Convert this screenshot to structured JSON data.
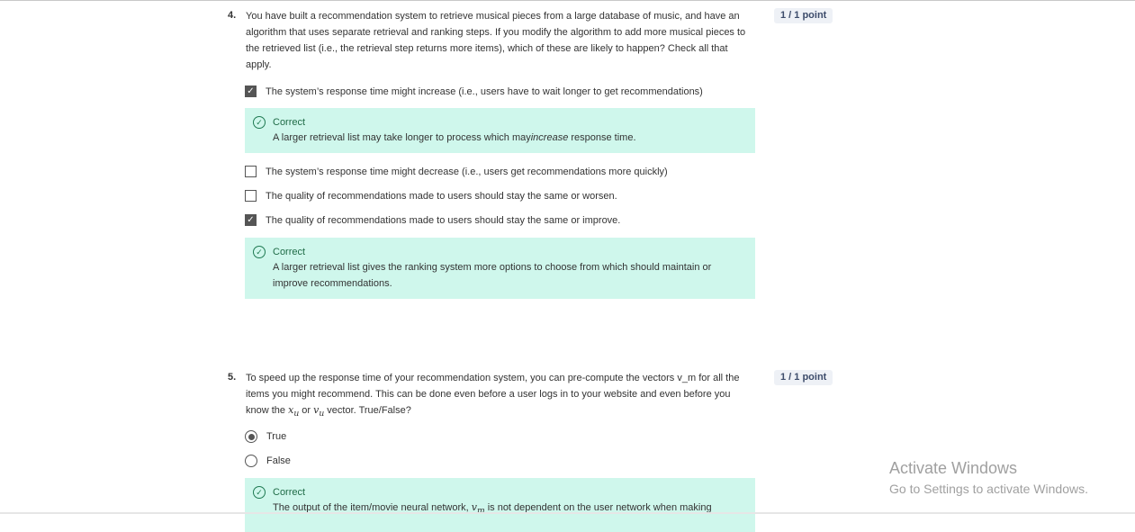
{
  "questions": [
    {
      "number": "4.",
      "text": "You have built a recommendation system to retrieve musical pieces from a large database of music, and have an algorithm that uses separate retrieval and ranking steps. If you modify the algorithm to add more musical pieces to the retrieved list (i.e., the retrieval step returns more items), which of these are likely to happen? Check all that apply.",
      "score": "1 / 1 point",
      "options": [
        {
          "label": "The system’s response time might increase (i.e., users have to wait longer to get recommendations)",
          "checked": true
        },
        {
          "label": "The system’s response time might decrease (i.e., users get recommendations more quickly)",
          "checked": false
        },
        {
          "label": "The quality of recommendations made to users should stay the same or worsen.",
          "checked": false
        },
        {
          "label": "The quality of recommendations made to users should stay the same or improve.",
          "checked": true
        }
      ],
      "feedback": [
        {
          "title": "Correct",
          "body_pre": "A larger retrieval list may take longer to process which may",
          "body_em": "increase",
          "body_post": " response time."
        },
        {
          "title": "Correct",
          "body": "A larger retrieval list gives the ranking system more options to choose from which should maintain or improve recommendations."
        }
      ]
    },
    {
      "number": "5.",
      "text_pre": "To speed up the response time of your recommendation system, you can pre-compute the vectors v_m for all the items you might recommend. This can be done even before a user logs in to your website and even before you know the ",
      "math1": "x",
      "math1_sub": "u",
      "text_mid": " or ",
      "math2": "v",
      "math2_sub": "u",
      "text_post": " vector. True/False?",
      "score": "1 / 1 point",
      "options": [
        {
          "label": "True",
          "selected": true
        },
        {
          "label": "False",
          "selected": false
        }
      ],
      "feedback": {
        "title": "Correct",
        "body_pre": "The output of the item/movie neural network, ",
        "math": "v",
        "math_sub": "m",
        "body_post": " is not dependent on the user network when making"
      }
    }
  ],
  "watermark": {
    "title": "Activate Windows",
    "subtitle": "Go to Settings to activate Windows."
  },
  "colors": {
    "feedback_bg": "#cff7ec",
    "correct_text": "#1f6b46",
    "badge_bg": "#eef1f6"
  }
}
